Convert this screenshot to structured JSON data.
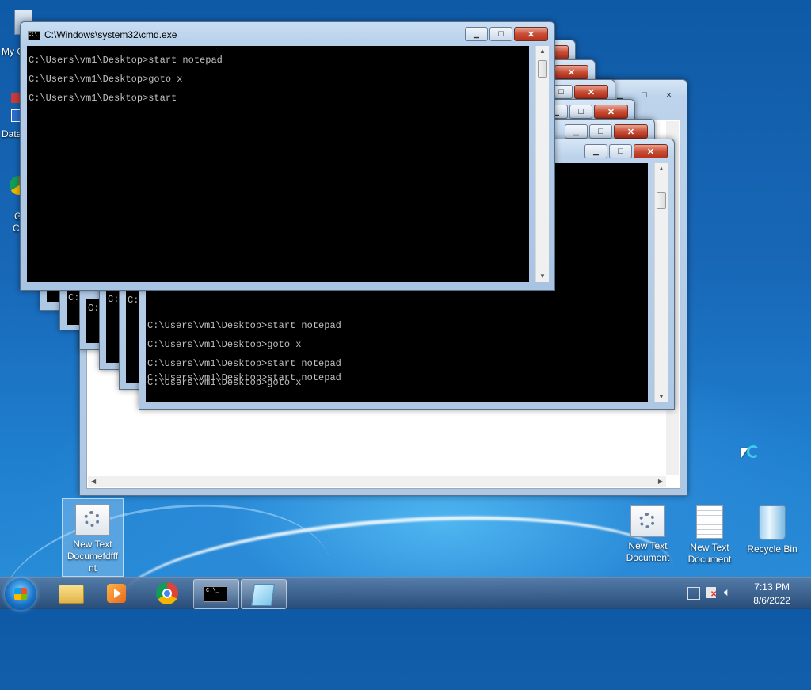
{
  "desktop": {
    "left_icons": [
      {
        "label": "My C",
        "top": 0
      },
      {
        "label": "Data",
        "top": 0
      },
      {
        "label": "G",
        "top": 0
      },
      {
        "label": "C",
        "top": 0
      }
    ],
    "icons": [
      {
        "label": "New Text Documefdfff nt"
      },
      {
        "label": "New Text Document"
      },
      {
        "label": "New Text Document"
      },
      {
        "label": "Recycle Bin"
      }
    ]
  },
  "cmd_window": {
    "title": "C:\\Windows\\system32\\cmd.exe",
    "lines": [
      "C:\\Users\\vm1\\Desktop>start notepad",
      "C:\\Users\\vm1\\Desktop>goto x",
      "C:\\Users\\vm1\\Desktop>start"
    ]
  },
  "back_window": {
    "lines": [
      "C:\\Users\\vm1\\Desktop>start notepad",
      "C:\\Users\\vm1\\Desktop>goto x",
      "C:\\Users\\vm1\\Desktop>start notepad",
      "C:\\Users\\vm1\\Desktop>goto x",
      "C:\\Users\\vm1\\Desktop>start notepad"
    ],
    "stacked_prefix": "C:"
  },
  "taskbar": {
    "time": "7:13 PM",
    "date": "8/6/2022",
    "cmd_icon_text": "C:\\_"
  },
  "colors": {
    "desktop_blue": "#1868b8",
    "close_red": "#c94d34"
  }
}
